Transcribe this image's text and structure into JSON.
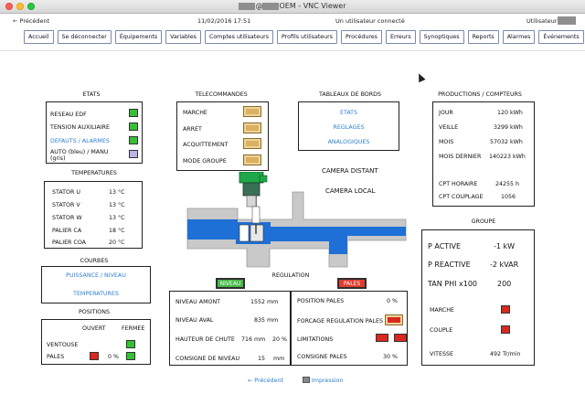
{
  "window": {
    "title": "OEM - VNC Viewer",
    "title_prefix": "@"
  },
  "header": {
    "back": "← Précédent",
    "datetime": "11/02/2016 17:51",
    "connected": "Un utilisateur connecté",
    "user_label": "Utilisateur:"
  },
  "nav": [
    "Accueil",
    "Se déconnecter",
    "Équipements",
    "Variables",
    "Comptes utilisateurs",
    "Profils utilisateurs",
    "Procédures",
    "Erreurs",
    "Synoptiques",
    "Reports",
    "Alarmes",
    "Événements"
  ],
  "etats": {
    "title": "ETATS",
    "items": [
      {
        "label": "RESEAU EDF",
        "color": "#34c234"
      },
      {
        "label": "TENSION AUXILIAIRE",
        "color": "#34c234"
      },
      {
        "label": "DEFAUTS / ALARMES",
        "color": "#34c234"
      },
      {
        "label": "AUTO (bleu) / MANU (gris)",
        "color": "#b9b3ea"
      }
    ]
  },
  "temperatures": {
    "title": "TEMPERATURES",
    "rows": [
      {
        "label": "STATOR U",
        "value": "13 °C"
      },
      {
        "label": "STATOR V",
        "value": "13 °C"
      },
      {
        "label": "STATOR W",
        "value": "13 °C"
      },
      {
        "label": "PALIER CA",
        "value": "18 °C"
      },
      {
        "label": "PALIER COA",
        "value": "20 °C"
      }
    ]
  },
  "courbes": {
    "title": "COURBES",
    "links": [
      "PUISSANCE / NIVEAU",
      "TEMPERATURES"
    ]
  },
  "positions": {
    "title": "POSITIONS",
    "col_open": "OUVERT",
    "col_closed": "FERMEE",
    "rows": [
      {
        "label": "VENTOUSE",
        "value": ""
      },
      {
        "label": "PALES",
        "value": "0 %"
      }
    ]
  },
  "telecommandes": {
    "title": "TELECOMMANDES",
    "items": [
      "MARCHE",
      "ARRET",
      "ACQUITTEMENT",
      "MODE GROUPE"
    ]
  },
  "tableaux": {
    "title": "TABLEAUX DE BORDS",
    "links": [
      "ETATS",
      "REGLAGES",
      "ANALOGIQUES"
    ]
  },
  "camera": {
    "distant": "CAMERA DISTANT",
    "local": "CAMERA LOCAL"
  },
  "productions": {
    "title": "PRODUCTIONS / COMPTEURS",
    "rows": [
      {
        "label": "JOUR",
        "value": "120 kWh"
      },
      {
        "label": "VEILLE",
        "value": "3299 kWh"
      },
      {
        "label": "MOIS",
        "value": "57032 kWh"
      },
      {
        "label": "MOIS DERNIER",
        "value": "140223 kWh"
      },
      {
        "label": "CPT HORAIRE",
        "value": "24255 h"
      },
      {
        "label": "CPT COUPLAGE",
        "value": "1056"
      }
    ]
  },
  "groupe": {
    "title": "GROUPE",
    "big": [
      {
        "label": "P ACTIVE",
        "value": "-1 kW"
      },
      {
        "label": "P REACTIVE",
        "value": "-2 kVAR"
      },
      {
        "label": "TAN PHI x100",
        "value": "200"
      }
    ],
    "marche": "MARCHE",
    "couple": "COUPLE",
    "vitesse_label": "VITESSE",
    "vitesse_value": "492 Tr/min"
  },
  "regulation": {
    "title": "REGULATION",
    "niveau_tag": "NIVEAU",
    "pales_tag": "PALES",
    "left": [
      {
        "label": "NIVEAU AMONT",
        "value": "1552 mm",
        "extra": ""
      },
      {
        "label": "NIVEAU AVAL",
        "value": "835 mm",
        "extra": ""
      },
      {
        "label": "HAUTEUR DE CHUTE",
        "value": "716 mm",
        "extra": "20 %"
      },
      {
        "label": "CONSIGNE  DE NIVEAU",
        "value": "15",
        "extra": "mm"
      }
    ],
    "right": [
      {
        "label": "POSITION PALES",
        "value": "0 %"
      },
      {
        "label": "FORCAGE REGULATION PALES",
        "value": ""
      },
      {
        "label": "LIMITATIONS",
        "value": ""
      },
      {
        "label": "CONSIGNE PALES",
        "value": "30 %"
      }
    ]
  },
  "footer": {
    "back": "← Précédent",
    "print": "Impression"
  }
}
